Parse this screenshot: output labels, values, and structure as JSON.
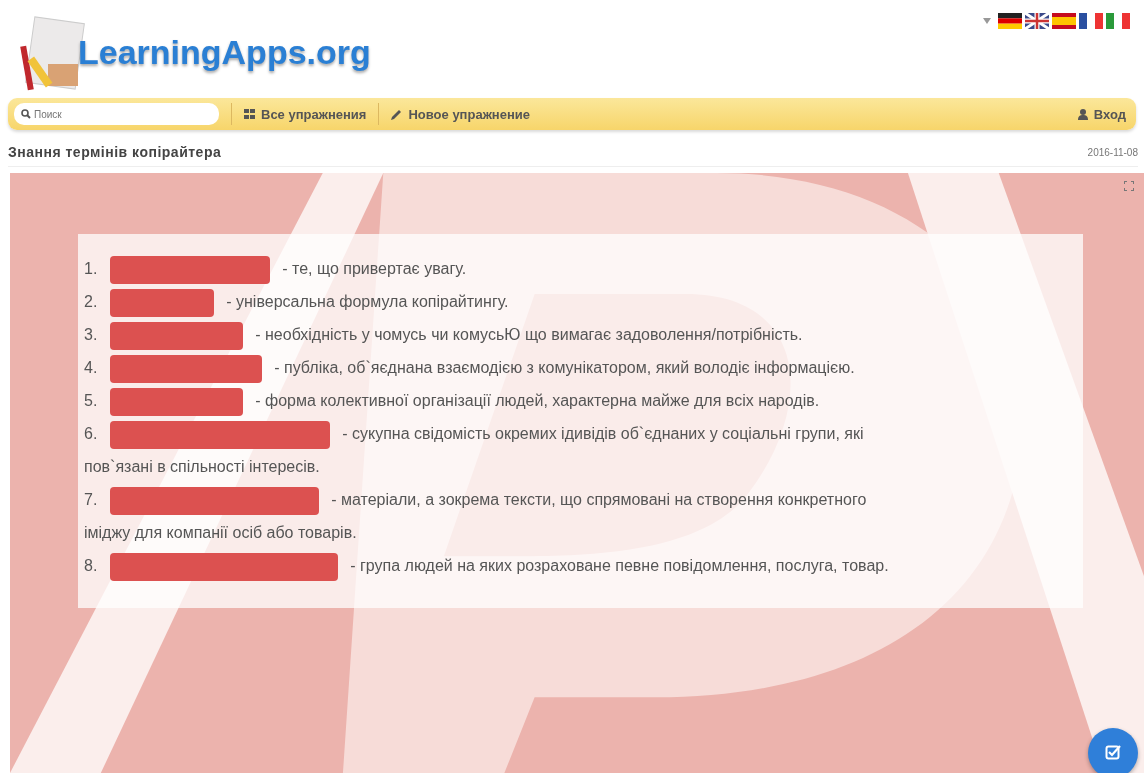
{
  "logo": {
    "text": "LearningApps.org"
  },
  "nav": {
    "search": {
      "placeholder": "Поиск"
    },
    "items": [
      {
        "label": "Все упражнения",
        "kind": "grid"
      },
      {
        "label": "Новое упражнение",
        "kind": "pencil"
      }
    ],
    "login": "Вход"
  },
  "page": {
    "title": "Знання термінів копірайтера",
    "date": "2016-11-08"
  },
  "items": [
    {
      "number": "1.",
      "text": "- те, що привертає увагу."
    },
    {
      "number": "2.",
      "text": "- універсальна формула копірайтингу."
    },
    {
      "number": "3.",
      "text": "- необхідність у чомусь чи комусьЮ що вимагає задоволення/потрібність."
    },
    {
      "number": "4.",
      "text": "- публіка, об`яєднана взаємодією з комунікатором, який володіє інформацією."
    },
    {
      "number": "5.",
      "text": "- форма колективної організації людей, характерна майже для всіх народів."
    },
    {
      "number": "6.",
      "text": "- сукупна свідомість окремих ідивідів об`єднаних у соціальні групи, які",
      "continuation": "пов`язані в спільності інтересів."
    },
    {
      "number": "7.",
      "text": "- матеріали, а зокрема тексти, що спрямовані на створення конкретного",
      "continuation": "іміджу для компанії осіб або товарів."
    },
    {
      "number": "8.",
      "text": "- група людей на яких розраховане певне повідомлення, послуга, товар."
    }
  ]
}
